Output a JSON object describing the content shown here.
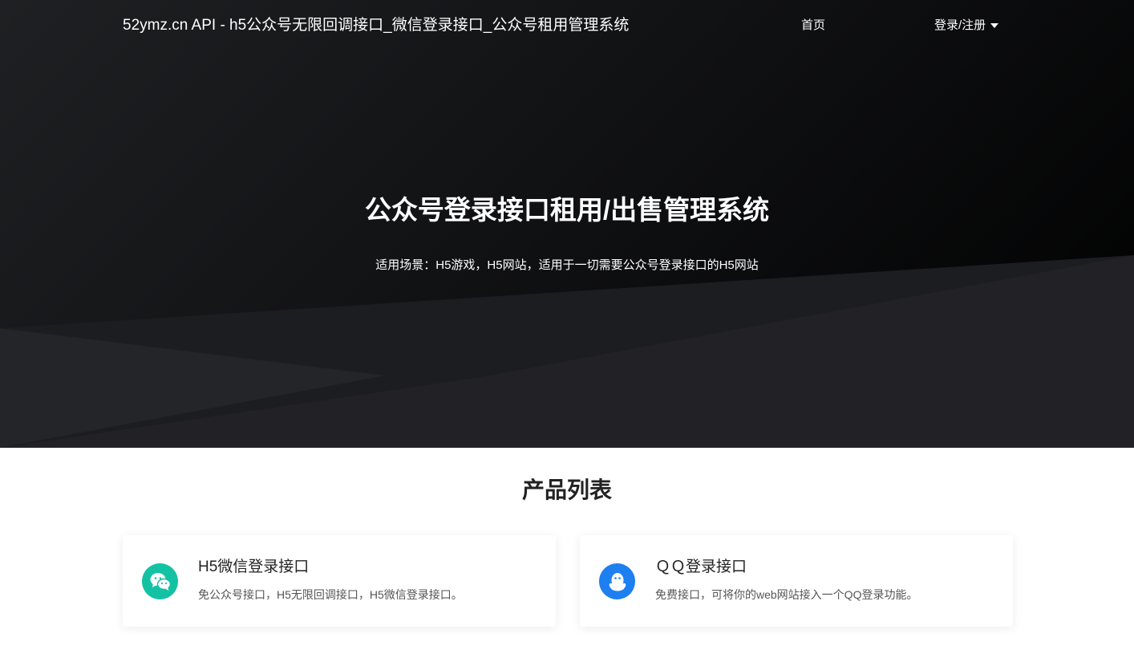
{
  "nav": {
    "brand": "52ymz.cn API - h5公众号无限回调接口_微信登录接口_公众号租用管理系统",
    "home": "首页",
    "login": "登录/注册",
    "login_icon": "caret-down-icon"
  },
  "hero": {
    "title_part1": "公众号登录",
    "title_bold1": "接口",
    "title_part2": "租",
    "title_bold2": "用",
    "title_part3": "/出售管理系统",
    "subtitle": "适用场景：H5游戏，H5网站，适用于一切需要公众号登录接口的H5网站"
  },
  "products": {
    "title": "产品列表",
    "items": [
      {
        "name": "H5微信登录接口",
        "desc": "免公众号接口，H5无限回调接口，H5微信登录接口。",
        "icon": "wechat-icon",
        "color": "#13c2a3"
      },
      {
        "name": "ＱＱ登录接口",
        "desc": "免费接口，可将你的web网站接入一个QQ登录功能。",
        "icon": "qq-icon",
        "color": "#1e7ff0"
      }
    ]
  }
}
